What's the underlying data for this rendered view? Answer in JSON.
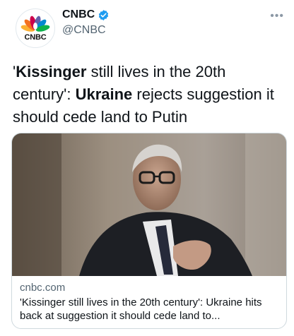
{
  "account": {
    "display_name": "CNBC",
    "handle": "@CNBC",
    "avatar_text": "CNBC",
    "verified": true,
    "more_label": "•••"
  },
  "tweet": {
    "segments": [
      {
        "text": "'",
        "bold": false
      },
      {
        "text": "Kissinger",
        "bold": true
      },
      {
        "text": " still lives in the 20th century': ",
        "bold": false
      },
      {
        "text": "Ukraine",
        "bold": true
      },
      {
        "text": " rejects suggestion it should cede land to Putin",
        "bold": false
      }
    ]
  },
  "card": {
    "domain": "cnbc.com",
    "title": "'Kissinger still lives in the 20th century': Ukraine hits back at suggestion it should cede land to..."
  },
  "colors": {
    "verified_blue": "#1d9bf0",
    "peacock": [
      "#fbb034",
      "#f37021",
      "#cc004c",
      "#6460aa",
      "#0089d0",
      "#0db14b"
    ]
  }
}
